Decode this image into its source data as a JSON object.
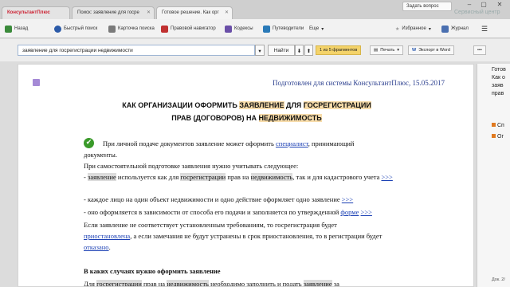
{
  "tabs": [
    {
      "label": "КонсультантПлюс"
    },
    {
      "label": "Поиск: заявление для госре"
    },
    {
      "label": "Готовое решение. Как орг"
    }
  ],
  "top": {
    "ask": "Задать вопрос",
    "brand": "Сервисный центр"
  },
  "toolbar": {
    "back": "Назад",
    "quick_search": "Быстрый поиск",
    "card_search": "Карточка поиска",
    "navigator": "Правовой навигатор",
    "codes": "Кодексы",
    "guides": "Путеводители",
    "more": "Еще",
    "favorites": "Избранное",
    "journal": "Журнал"
  },
  "search": {
    "value": "заявление для госрегистрации недвижимости",
    "find_label": "Найти",
    "found": "1 из 5 фрагментов",
    "print": "Печать",
    "export": "Экспорт в Word"
  },
  "doc": {
    "prepared": "Подготовлен для системы КонсультантПлюс, 15.05.2017",
    "title1_a": "КАК ОРГАНИЗАЦИИ ОФОРМИТЬ ",
    "title1_b": "ЗАЯВЛЕНИЕ",
    "title1_c": " ДЛЯ ",
    "title1_d": "ГОСРЕГИСТРАЦИИ",
    "title2_a": "ПРАВ (ДОГОВОРОВ) НА ",
    "title2_b": "НЕДВИЖИМОСТЬ",
    "p1_a": "При личной подаче документов заявление может оформить ",
    "p1_link": "специалист",
    "p1_b": ", принимающий",
    "p1_c": "документы.",
    "p2": "При самостоятельной подготовке заявления нужно учитывать следующее:",
    "p3_a": "- ",
    "p3_b": "заявление",
    "p3_c": " используется как для ",
    "p3_d": "госрегистрации",
    "p3_e": " прав на ",
    "p3_f": "недвижимость",
    "p3_g": ", так и для кадастрового учета ",
    "p4": "- каждое лицо на один объект недвижимости и одно действие оформляет одно заявление ",
    "p5_a": "- оно оформляется в зависимости от способа его подачи и заполняется по утвержденной ",
    "p5_link": "форме",
    "more_link": ">>>",
    "p6_a": "Если заявление не соответствует установленным требованиям, то госрегистрация будет",
    "p6_link": "приостановлена",
    "p6_b": ", а если замечания не будут устранены в срок приостановления, то в регистрации будет",
    "p6_link2": "отказано",
    "p6_c": ".",
    "h2": "В каких случаях нужно оформить заявление",
    "p7_a": "Для ",
    "p7_b": "госрегистрации",
    "p7_c": " прав на ",
    "p7_d": "недвижимость",
    "p7_e": " необходимо заполнить и подать ",
    "p7_f": "заявление",
    "p7_g": " за"
  },
  "right": {
    "t1": "Готов",
    "t2": "Как о",
    "t3": "заяв",
    "t4": "прав",
    "c1": "Сп",
    "c2": "Ог",
    "bottom": "Док. 2/"
  }
}
